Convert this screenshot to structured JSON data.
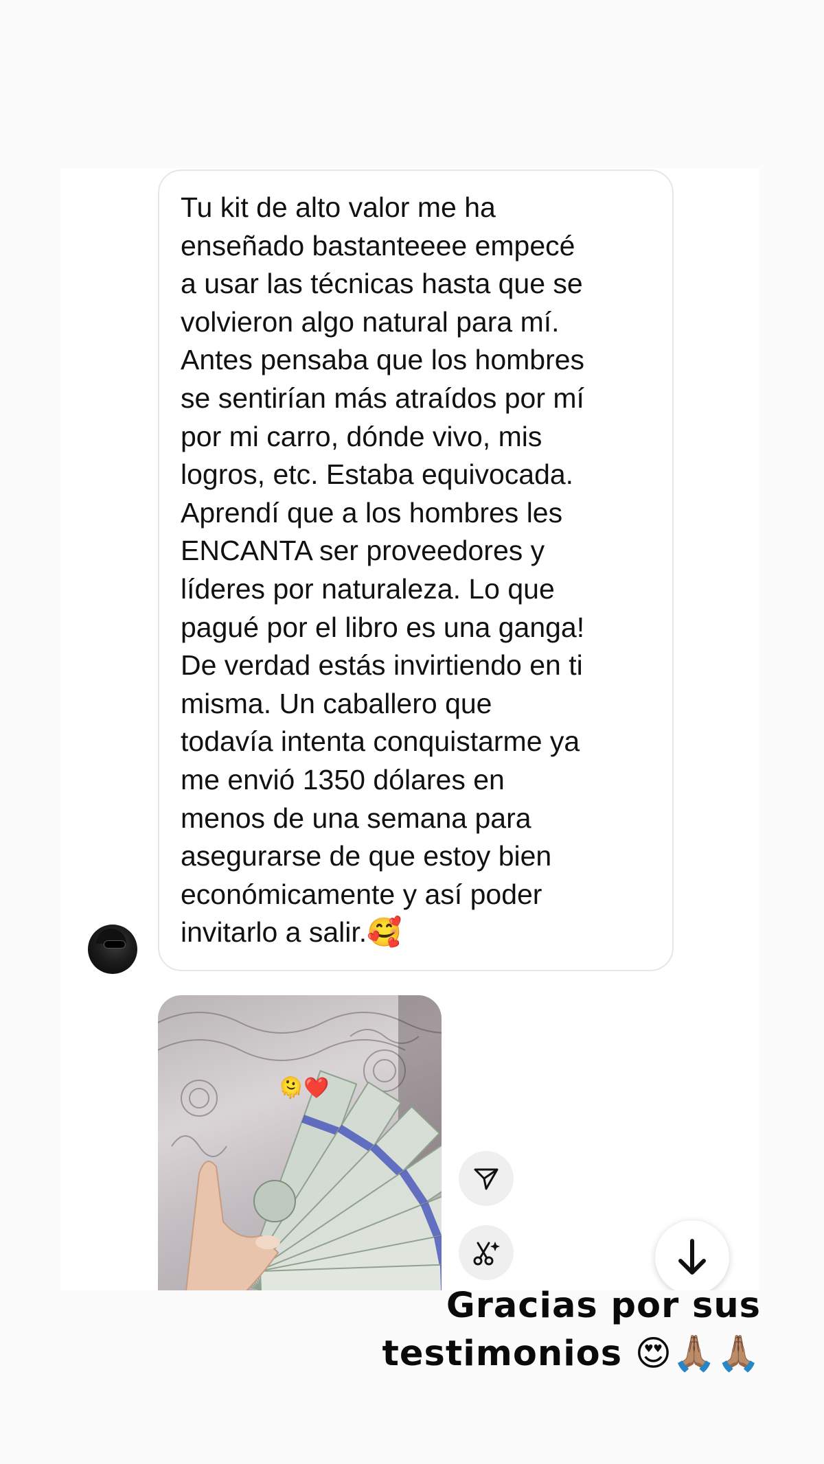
{
  "message": {
    "text": "Tu kit de alto valor me ha\nenseñado bastanteeee empecé\na usar las técnicas hasta que se\nvolvieron algo natural para mí.\nAntes pensaba que los hombres\nse sentirían más atraídos por mí\npor mi carro, dónde vivo, mis\nlogros, etc. Estaba equivocada.\nAprendí que a los hombres les\nENCANTA ser proveedores y\nlíderes por naturaleza. Lo que\npagué por el libro es una ganga!\nDe verdad estás invirtiendo en ti\nmisma. Un caballero que\ntodavía intenta conquistarme ya\nme envió 1350 dólares en\nmenos de una semana para\nasegurarse de que estoy bien\neconómicamente y así poder\ninvitarlo a salir.🥰"
  },
  "photo": {
    "overlay_emoji": "🫠❤️"
  },
  "icons": {
    "share": "paper-plane-icon",
    "ai": "scissors-sparkle-icon",
    "scroll": "arrow-down-icon"
  },
  "caption": {
    "line1": "Gracias por sus",
    "line2": "testimonios 😍🙏🏽🙏🏽"
  },
  "colors": {
    "background": "#fbfbfb",
    "bubble_border": "#e6e6e6",
    "button_gray": "#efefef",
    "text": "#111111"
  }
}
